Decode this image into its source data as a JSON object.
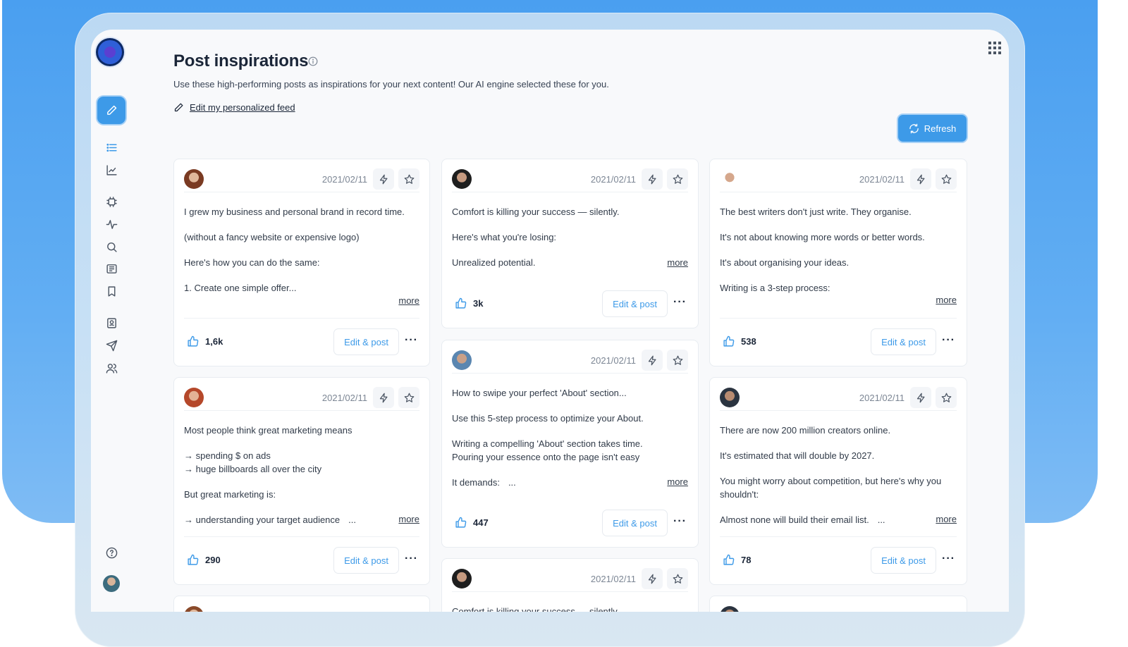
{
  "header": {
    "title": "Post inspirations",
    "subtitle": "Use these high-performing posts as inspirations for your next content! Our AI engine selected these for you.",
    "edit_feed_label": "Edit my personalized feed",
    "refresh_label": "Refresh"
  },
  "sidebar": {
    "items": [
      "edit",
      "list",
      "analytics",
      "ai-chip",
      "activity",
      "search",
      "news",
      "bookmark",
      "contacts",
      "send",
      "team"
    ],
    "help": "help"
  },
  "colors": {
    "accent": "#3d9ae8",
    "background": "#f8f9fb",
    "brand_bg": "#4a9ff0"
  },
  "posts": [
    {
      "date": "2021/02/11",
      "lines": [
        "I grew my business and personal brand in record time.",
        "(without a fancy website or expensive logo)",
        "Here's how you can do the same:",
        "1. Create one simple offer..."
      ],
      "more": "more",
      "likes": "1,6k",
      "edit_label": "Edit & post",
      "menu": "···"
    },
    {
      "date": "2021/02/11",
      "lines": [
        "Comfort is killing your success — silently.",
        "Here's what you're losing:",
        "Unrealized potential."
      ],
      "more": "more",
      "likes": "3k",
      "edit_label": "Edit & post",
      "menu": "···"
    },
    {
      "date": "2021/02/11",
      "lines": [
        "The best writers don't just write. They organise.",
        "It's not about knowing more words or better words.",
        "It's about organising your ideas.",
        "Writing is a 3-step process:"
      ],
      "more": "more",
      "likes": "538",
      "edit_label": "Edit & post",
      "menu": "···"
    },
    {
      "date": "2021/02/11",
      "lines": [
        "Most people think great marketing means",
        "→ spending $ on ads",
        "→ huge billboards all over the city",
        "But great marketing is:",
        "→ understanding your target audience",
        "..."
      ],
      "more": "more",
      "likes": "290",
      "edit_label": "Edit & post",
      "menu": "···"
    },
    {
      "date": "2021/02/11",
      "lines": [
        "How to swipe your perfect 'About' section...",
        "Use this 5-step process to optimize your About.",
        "Writing a compelling 'About' section takes time.",
        "Pouring your essence onto the page isn't easy",
        "It demands:",
        "..."
      ],
      "more": "more",
      "likes": "447",
      "edit_label": "Edit & post",
      "menu": "···"
    },
    {
      "date": "2021/02/11",
      "lines": [
        "There are now 200 million creators online.",
        "It's estimated that will double by 2027.",
        "You might worry about competition, but here's why you shouldn't:",
        "Almost none will build their email list.",
        "..."
      ],
      "more": "more",
      "likes": "78",
      "edit_label": "Edit & post",
      "menu": "···"
    },
    {
      "date": "2021/02/11",
      "lines": [
        "Comfort is killing your success — silently."
      ]
    }
  ]
}
